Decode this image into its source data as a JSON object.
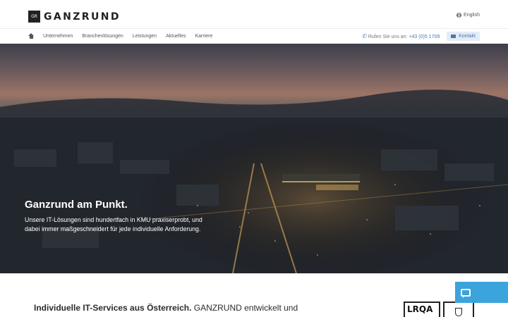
{
  "brand": {
    "logo_mark": "GR",
    "name": "GANZRUND"
  },
  "language": {
    "label": "English",
    "icon": "globe-icon"
  },
  "nav": {
    "home_icon": "home-icon",
    "items": [
      {
        "label": "Unternehmen"
      },
      {
        "label": "Branchenlösungen"
      },
      {
        "label": "Leistungen"
      },
      {
        "label": "Aktuelles"
      },
      {
        "label": "Karriere"
      }
    ],
    "phone_prefix": "Rufen Sie uns an:",
    "phone_number": "+43 (0)5 1709",
    "contact_label": "Kontakt"
  },
  "hero": {
    "title": "Ganzrund am Punkt.",
    "description": "Unsere IT-Lösungen sind hundertfach in KMU praxiserprobt, und dabei immer maßgeschneidert für jede individuelle Anforderung."
  },
  "intro": {
    "bold": "Individuelle IT-Services aus Österreich.",
    "rest": " GANZRUND entwickelt und"
  },
  "certs": {
    "lrqa": "LRQA"
  },
  "chat": {
    "icon": "chat-icon"
  },
  "colors": {
    "accent": "#4a77a8",
    "chat": "#3ba4dc"
  }
}
